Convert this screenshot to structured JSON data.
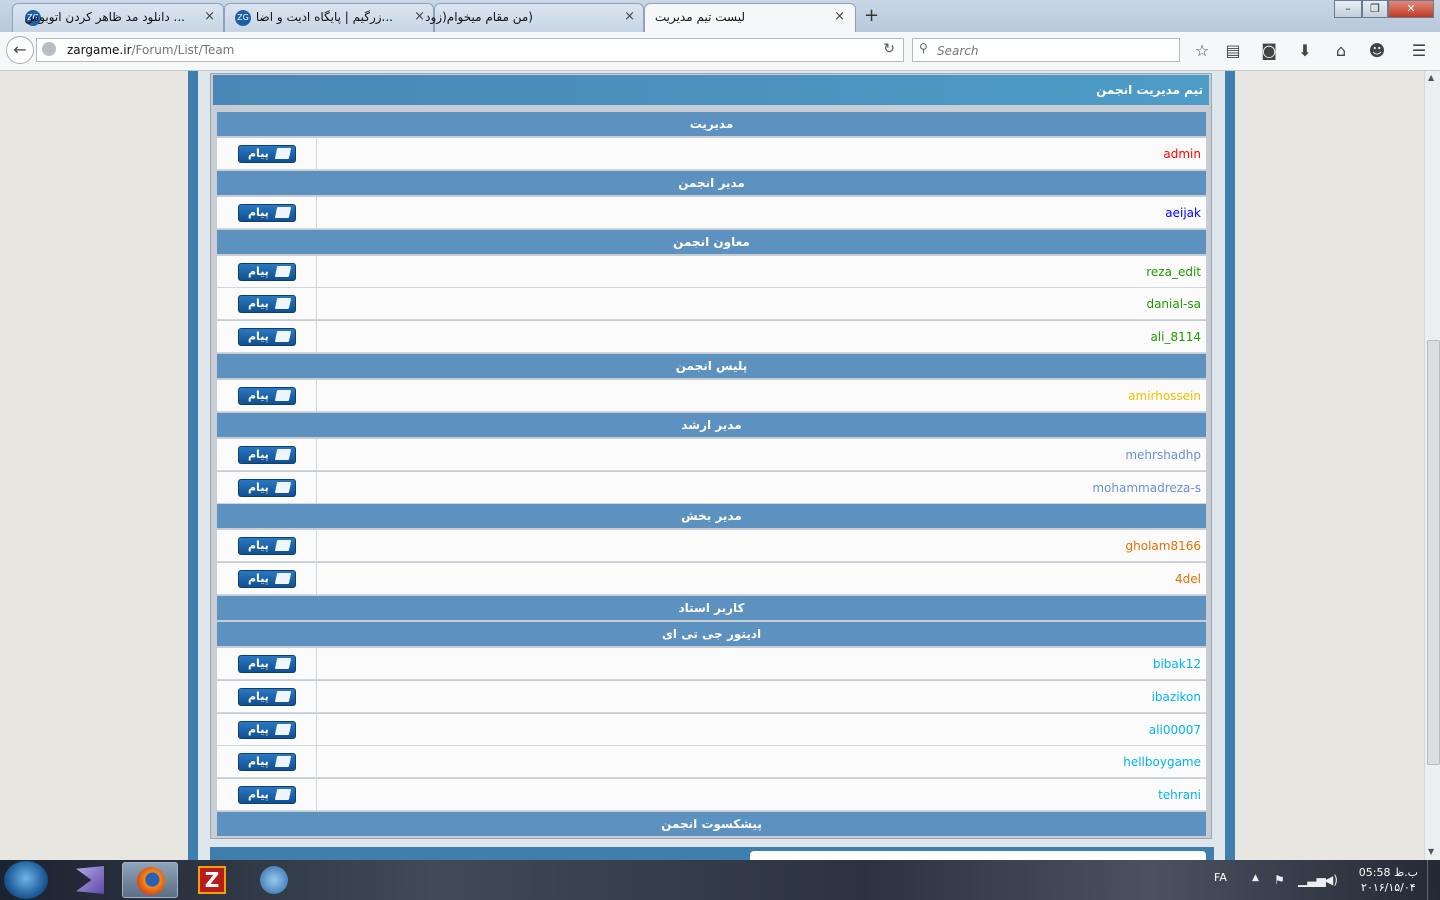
{
  "browser": {
    "tabs": [
      {
        "title": "... دانلود مد ظاهر کردن اتوبوس",
        "favicon": "zg-icon",
        "active": false
      },
      {
        "title": "...زرگیم | پایگاه ادیت و اضا",
        "favicon": "zg-icon",
        "active": false
      },
      {
        "title": "(من مقام میخوام(زود",
        "favicon": "",
        "active": false
      },
      {
        "title": "لیست تیم مدیریت",
        "favicon": "",
        "active": true
      }
    ],
    "new_tab": "+",
    "close_glyph": "×",
    "url_domain": "zargame.ir",
    "url_path": "/Forum/List/Team",
    "search_placeholder": "Search",
    "window_controls": {
      "minimize": "–",
      "maximize": "❐",
      "close": "✕"
    }
  },
  "panel": {
    "title": "تیم مدیریت انجمن",
    "message_label": "پیام"
  },
  "groups": [
    {
      "name": "مدیریت",
      "members": [
        {
          "user": "admin",
          "color": "#ff0000"
        }
      ]
    },
    {
      "name": "مدیر انجمن",
      "members": [
        {
          "user": "aeijak",
          "color": "#0000ff"
        }
      ]
    },
    {
      "name": "معاون انجمن",
      "members": [
        {
          "user": "reza_edit",
          "color": "#1f9a00"
        },
        {
          "user": "danial-sa",
          "color": "#1f9a00"
        },
        {
          "user": "ali_8114",
          "color": "#1f9a00"
        }
      ]
    },
    {
      "name": "پلیس انجمن",
      "members": [
        {
          "user": "amirhossein",
          "color": "#f0c000"
        }
      ]
    },
    {
      "name": "مدیر ارشد",
      "members": [
        {
          "user": "mehrshadhp",
          "color": "#6a90d6"
        },
        {
          "user": "mohammadreza-s",
          "color": "#6a90d6"
        }
      ]
    },
    {
      "name": "مدیر بخش",
      "members": [
        {
          "user": "gholam8166",
          "color": "#e07000"
        },
        {
          "user": "4del",
          "color": "#e07000"
        }
      ]
    },
    {
      "name": "کاربر استاد",
      "members": []
    },
    {
      "name": "ادیتور جی تی ای",
      "members": [
        {
          "user": "bibak12",
          "color": "#00b4f0"
        },
        {
          "user": "ibazikon",
          "color": "#00b4f0"
        },
        {
          "user": "ali00007",
          "color": "#00b4f0"
        },
        {
          "user": "hellboygame",
          "color": "#00b4f0"
        },
        {
          "user": "tehrani",
          "color": "#00b4f0"
        }
      ]
    },
    {
      "name": "پیشکسوت انجمن",
      "members": []
    }
  ],
  "taskbar": {
    "language": "FA",
    "time": "05:58 ب.ظ",
    "date": "۲۰۱۶/۱۵/۰۴"
  }
}
